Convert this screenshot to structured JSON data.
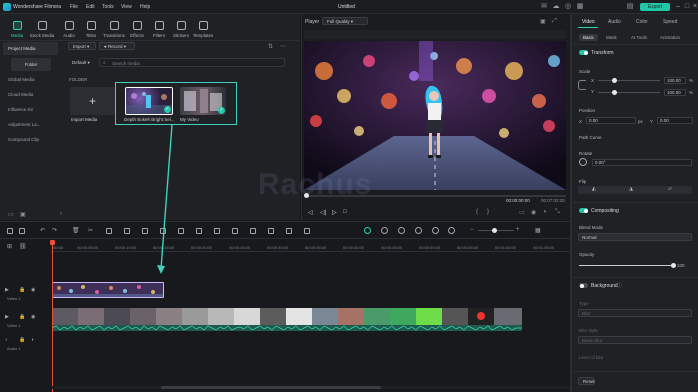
{
  "app": {
    "name": "Wondershare Filmora",
    "project_title": "Untitled",
    "menu": [
      "File",
      "Edit",
      "Tools",
      "View",
      "Help"
    ],
    "export_label": "Export"
  },
  "media_tabs": [
    {
      "label": "Media",
      "icon": "media-icon",
      "active": true
    },
    {
      "label": "Stock Media",
      "icon": "stock-media-icon",
      "active": false
    },
    {
      "label": "Audio",
      "icon": "audio-icon",
      "active": false
    },
    {
      "label": "Titles",
      "icon": "titles-icon",
      "active": false
    },
    {
      "label": "Transitions",
      "icon": "transitions-icon",
      "active": false
    },
    {
      "label": "Effects",
      "icon": "effects-icon",
      "active": false
    },
    {
      "label": "Filters",
      "icon": "filters-icon",
      "active": false
    },
    {
      "label": "Stickers",
      "icon": "stickers-icon",
      "active": false
    },
    {
      "label": "Templates",
      "icon": "templates-icon",
      "active": false
    }
  ],
  "sidebar": {
    "project_media": "Project Media",
    "folder": "Folder",
    "items": [
      "Global Media",
      "Cloud Media",
      "Influence Kit",
      "Adjustment La...",
      "Compound Clip"
    ]
  },
  "media": {
    "import_label": "Import",
    "record_label": "Record",
    "default_label": "Default",
    "search_placeholder": "Search media",
    "folder_label": "FOLDER",
    "import_media_label": "Import Media",
    "items": [
      {
        "name": "Depth Bokeh Bright Sel..."
      },
      {
        "name": "My Video"
      }
    ]
  },
  "player": {
    "label": "Player",
    "quality": "Full Quality",
    "current_time": "00:00:00:00",
    "total_time": "00:07:02:20"
  },
  "properties": {
    "tabs": [
      "Video",
      "Audio",
      "Color",
      "Speed"
    ],
    "active_tab": "Video",
    "subtabs": [
      "Basic",
      "Mask",
      "AI Tools",
      "Animation"
    ],
    "active_subtab": "Basic",
    "transform": "Transform",
    "scale": "Scale",
    "scale_x": "100.00",
    "scale_y": "100.00",
    "x_label": "X",
    "y_label": "Y",
    "percent": "%",
    "position": "Position",
    "position_x": "0.00",
    "position_y": "0.00",
    "px": "px",
    "path_curve": "Path Curve",
    "rotate": "Rotate",
    "rotate_value": "0.00°",
    "flip": "Flip",
    "compositing": "Compositing",
    "blend_mode": "Blend Mode",
    "blend_value": "Normal",
    "opacity": "Opacity",
    "opacity_value": "100",
    "background": "Background",
    "blur_style_label": "Type",
    "blur_style_value": "Blur",
    "blur_level_label": "Blur style",
    "blur_level_value": "Basic Blur",
    "level_label": "Level of blur",
    "reset": "Reset"
  },
  "timeline": {
    "ticks": [
      "00:00",
      "00:00:05:00",
      "00:00:10:00",
      "00:00:15:00",
      "00:00:20:00",
      "00:00:25:00",
      "00:00:30:00",
      "00:00:35:00",
      "00:00:40:00",
      "00:00:45:00",
      "00:00:50:00",
      "00:00:55:00",
      "00:01:00:00",
      "00:01:05:00"
    ],
    "tracks": [
      "Video 2",
      "Video 1",
      "Audio 1"
    ]
  },
  "watermark": "Rachus"
}
